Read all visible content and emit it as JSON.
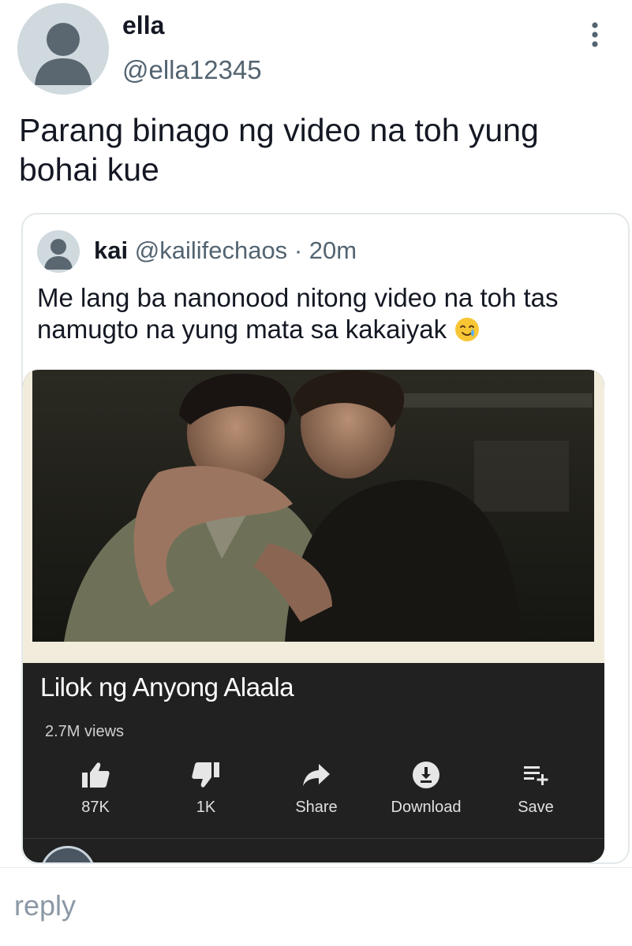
{
  "tweet": {
    "author_name": "ella",
    "author_handle": "@ella12345",
    "text": "Parang binago ng video na toh yung bohai kue",
    "menu_icon": "more-vertical-icon"
  },
  "quote": {
    "author_name": "kai",
    "author_handle": "@kailifechaos",
    "separator": "·",
    "time": "20m",
    "text": "Me lang ba nanonood nitong video na toh tas namugto na yung mata sa kakaiyak",
    "emoji": "smiling-face-with-tear-emoji"
  },
  "video": {
    "title": "Lilok ng Anyong Alaala",
    "views": "2.7M views",
    "actions": [
      {
        "icon": "thumbs-up-icon",
        "label": "87K"
      },
      {
        "icon": "thumbs-down-icon",
        "label": "1K"
      },
      {
        "icon": "share-icon",
        "label": "Share"
      },
      {
        "icon": "download-icon",
        "label": "Download"
      },
      {
        "icon": "playlist-add-icon",
        "label": "Save"
      }
    ]
  },
  "reply": {
    "placeholder": "reply"
  }
}
